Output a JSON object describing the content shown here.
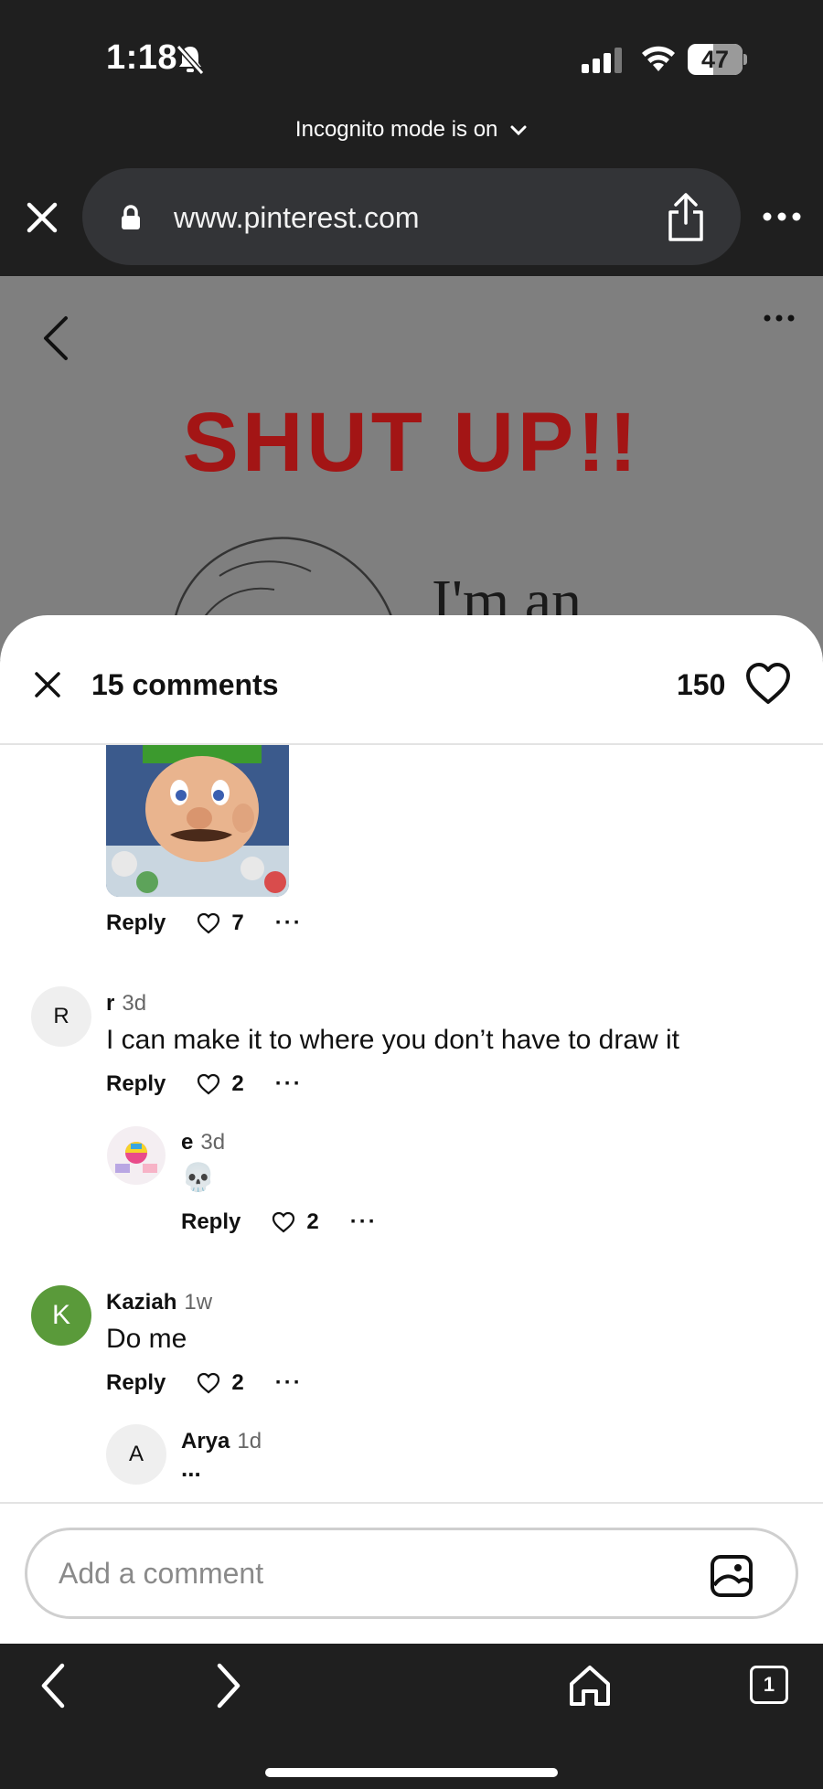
{
  "status_bar": {
    "time": "1:18",
    "battery": "47",
    "battery_level": 0.47
  },
  "browser": {
    "incognito_notice": "Incognito mode is on",
    "url": "www.pinterest.com"
  },
  "pin": {
    "headline": "SHUT UP!!",
    "subtext": "I'm an"
  },
  "comments_sheet": {
    "comment_count": "15 comments",
    "like_count": "150",
    "first_comment_actions": {
      "reply": "Reply",
      "likes": "7"
    },
    "comments": [
      {
        "avatar": "R",
        "author": "r",
        "age": "3d",
        "text": "I can make it to where you don’t have to draw it",
        "reply": "Reply",
        "likes": "2",
        "replies": [
          {
            "author": "e",
            "age": "3d",
            "text": "💀",
            "reply": "Reply",
            "likes": "2"
          }
        ]
      },
      {
        "avatar": "K",
        "avatar_color": "#5a9a3a",
        "author": "Kaziah",
        "age": "1w",
        "text": "Do me",
        "reply": "Reply",
        "likes": "2",
        "replies": [
          {
            "avatar": "A",
            "author": "Arya",
            "age": "1d",
            "text": "..."
          }
        ]
      }
    ],
    "input_placeholder": "Add a comment"
  },
  "bottom_nav": {
    "tab_count": "1"
  }
}
